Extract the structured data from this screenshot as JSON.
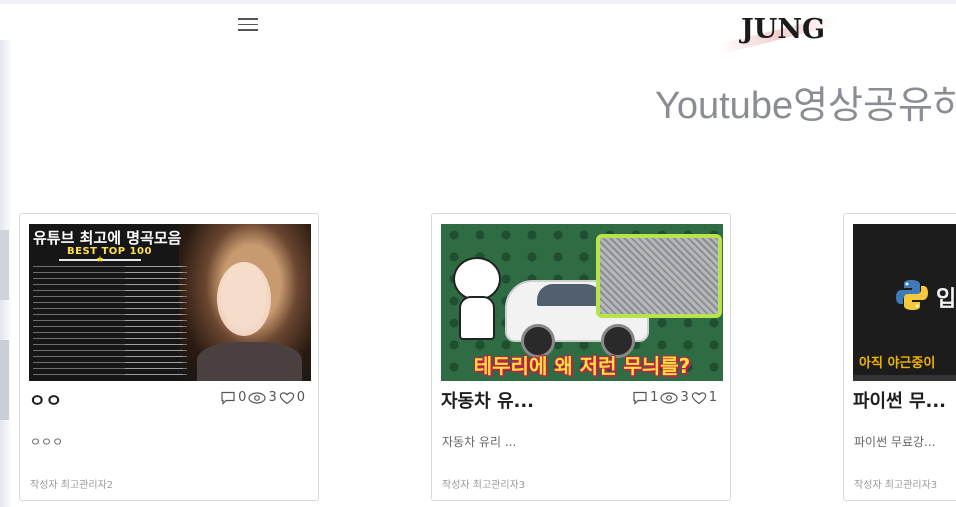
{
  "header": {
    "menu_icon": "hamburger-icon",
    "logo_text": "JUNG",
    "page_title": "Youtube영상공유하"
  },
  "posts": [
    {
      "title": "ㅇㅇ",
      "comments": "0",
      "views": "3",
      "likes": "0",
      "excerpt": "ㅇㅇㅇ",
      "author": "작성자 최고관리자2",
      "thumbnail": {
        "headline": "유튜브 최고에 명곡모음",
        "badge": "BEST TOP 100"
      }
    },
    {
      "title": "자동차 유...",
      "comments": "1",
      "views": "3",
      "likes": "1",
      "excerpt": "자동차 유리 ...",
      "author": "작성자 최고관리자3",
      "thumbnail": {
        "caption": "테두리에 왜 저런 무늬를?"
      }
    },
    {
      "title": "파이썬 무...",
      "excerpt": "파이썬 무료강...",
      "author": "작성자 최고관리자3",
      "thumbnail": {
        "text": "입",
        "caption": "아직 야근중이"
      }
    }
  ],
  "icons": {
    "comments": "comment-icon",
    "views": "eye-icon",
    "likes": "heart-icon"
  }
}
